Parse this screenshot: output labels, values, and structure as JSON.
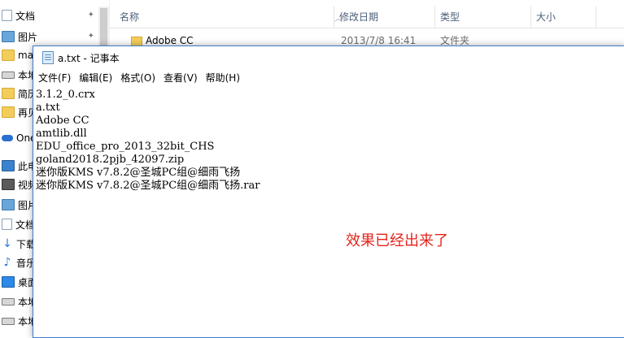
{
  "explorer": {
    "nav_items": [
      {
        "label": "文档",
        "icon": "document-icon",
        "pinned": true
      },
      {
        "label": "图片",
        "icon": "pictures-icon",
        "pinned": true
      },
      {
        "label": "mar",
        "icon": "folder-icon",
        "pinned": false
      },
      {
        "label": "本地",
        "icon": "drive-icon",
        "pinned": false
      },
      {
        "label": "简历",
        "icon": "folder-icon",
        "pinned": false
      },
      {
        "label": "再见",
        "icon": "folder-icon",
        "pinned": false
      },
      {
        "label": "OneD",
        "icon": "onedrive-icon",
        "pinned": false
      },
      {
        "label": "此电脑",
        "icon": "this-pc-icon",
        "pinned": false
      },
      {
        "label": "视频",
        "icon": "videos-icon",
        "pinned": false
      },
      {
        "label": "图片",
        "icon": "pictures-icon",
        "pinned": false
      },
      {
        "label": "文档",
        "icon": "document-icon",
        "pinned": false
      },
      {
        "label": "下载",
        "icon": "downloads-icon",
        "pinned": false
      },
      {
        "label": "音乐",
        "icon": "music-icon",
        "pinned": false
      },
      {
        "label": "桌面",
        "icon": "desktop-icon",
        "pinned": false
      },
      {
        "label": "本地",
        "icon": "drive-icon",
        "pinned": false
      },
      {
        "label": "本地",
        "icon": "drive-icon",
        "pinned": false
      }
    ],
    "columns": {
      "name": "名称",
      "modified": "修改日期",
      "type": "类型",
      "size": "大小"
    },
    "rows": [
      {
        "name": "Adobe CC",
        "modified": "2013/7/8 16:41",
        "type": "文件夹",
        "size": ""
      }
    ]
  },
  "notepad": {
    "title": "a.txt - 记事本",
    "menu": [
      {
        "label": "文件(F)"
      },
      {
        "label": "编辑(E)"
      },
      {
        "label": "格式(O)"
      },
      {
        "label": "查看(V)"
      },
      {
        "label": "帮助(H)"
      }
    ],
    "lines": [
      "3.1.2_0.crx",
      "a.txt",
      "Adobe CC",
      "amtlib.dll",
      "EDU_office_pro_2013_32bit_CHS",
      "goland2018.2pjb_42097.zip",
      "迷你版KMS v7.8.2@圣城PC组@细雨飞扬",
      "迷你版KMS v7.8.2@圣城PC组@细雨飞扬.rar"
    ]
  },
  "annotation": "效果已经出来了",
  "colors": {
    "annotation": "#e5231b",
    "window_border": "#3f7fcc",
    "column_header_text": "#4c607a"
  }
}
